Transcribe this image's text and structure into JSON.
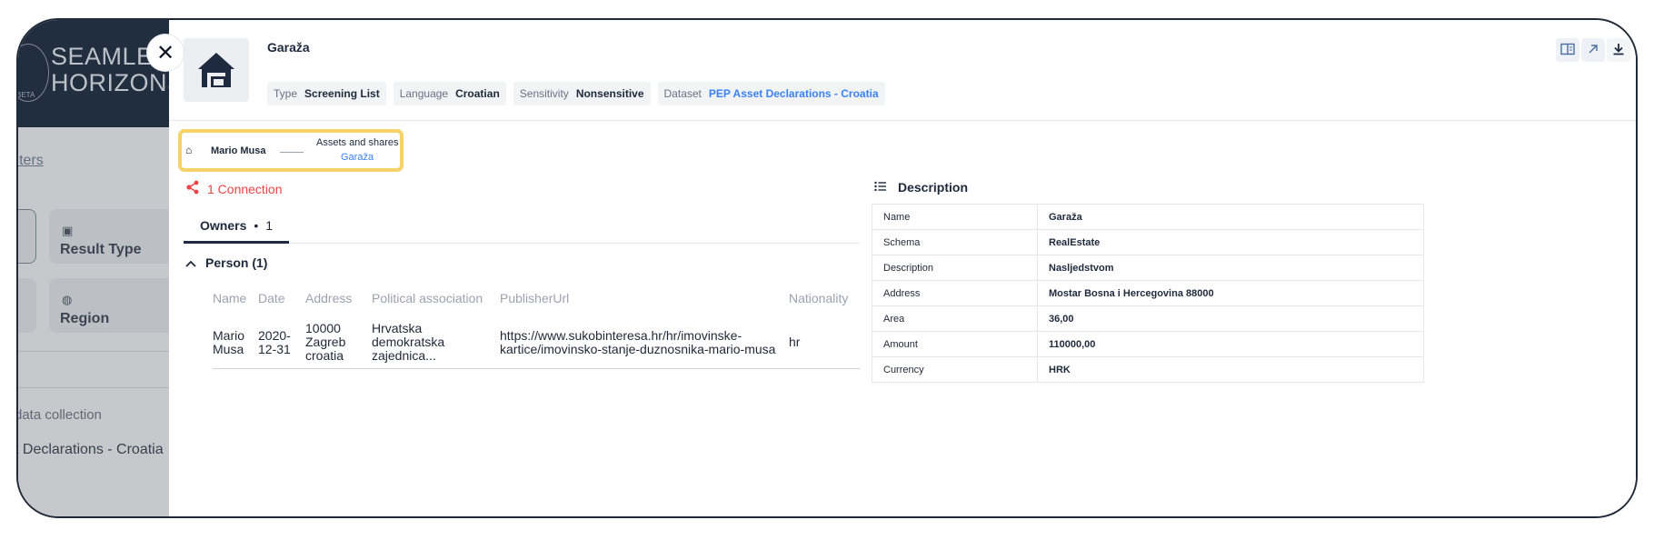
{
  "background": {
    "logo_text": "SEAMLESS\nHORIZONS",
    "beta": "BETA",
    "filters_link": "ilters",
    "cards": [
      {
        "label": "Result Type"
      },
      {
        "label": "Region"
      }
    ],
    "data_collection_label": "data collection",
    "dataset_value": "t Declarations - Croatia"
  },
  "entity": {
    "title": "Garaža",
    "tags": [
      {
        "key": "Type",
        "value": "Screening List"
      },
      {
        "key": "Language",
        "value": "Croatian"
      },
      {
        "key": "Sensitivity",
        "value": "Nonsensitive"
      },
      {
        "key": "Dataset",
        "value": "PEP Asset Declarations - Croatia"
      }
    ]
  },
  "breadcrumb": {
    "home": "⌂",
    "person": "Mario Musa",
    "relation": "Assets and shares",
    "current": "Garaža"
  },
  "connections": {
    "label": "1 Connection"
  },
  "owners_tab": {
    "label": "Owners",
    "count": "1"
  },
  "group": {
    "label": "Person (1)"
  },
  "owners_table": {
    "headers": [
      "Name",
      "Date",
      "Address",
      "Political association",
      "PublisherUrl",
      "Nationality"
    ],
    "rows": [
      {
        "name": "Mario Musa",
        "date": "2020-12-31",
        "address": "10000 Zagreb croatia",
        "political": "Hrvatska demokratska zajednica...",
        "url": "https://www.sukobinteresa.hr/hr/imovinske-kartice/imovinsko-stanje-duznosnika-mario-musa",
        "nationality": "hr"
      }
    ]
  },
  "description": {
    "title": "Description",
    "rows": [
      {
        "key": "Name",
        "value": "Garaža"
      },
      {
        "key": "Schema",
        "value": "RealEstate"
      },
      {
        "key": "Description",
        "value": "Nasljedstvom"
      },
      {
        "key": "Address",
        "value": "Mostar Bosna i Hercegovina 88000"
      },
      {
        "key": "Area",
        "value": "36,00"
      },
      {
        "key": "Amount",
        "value": "110000,00"
      },
      {
        "key": "Currency",
        "value": "HRK"
      }
    ]
  },
  "colors": {
    "accent": "#3b82f6",
    "connection": "#ef4444",
    "highlight": "#f6d36a",
    "navy": "#1e2a40"
  }
}
